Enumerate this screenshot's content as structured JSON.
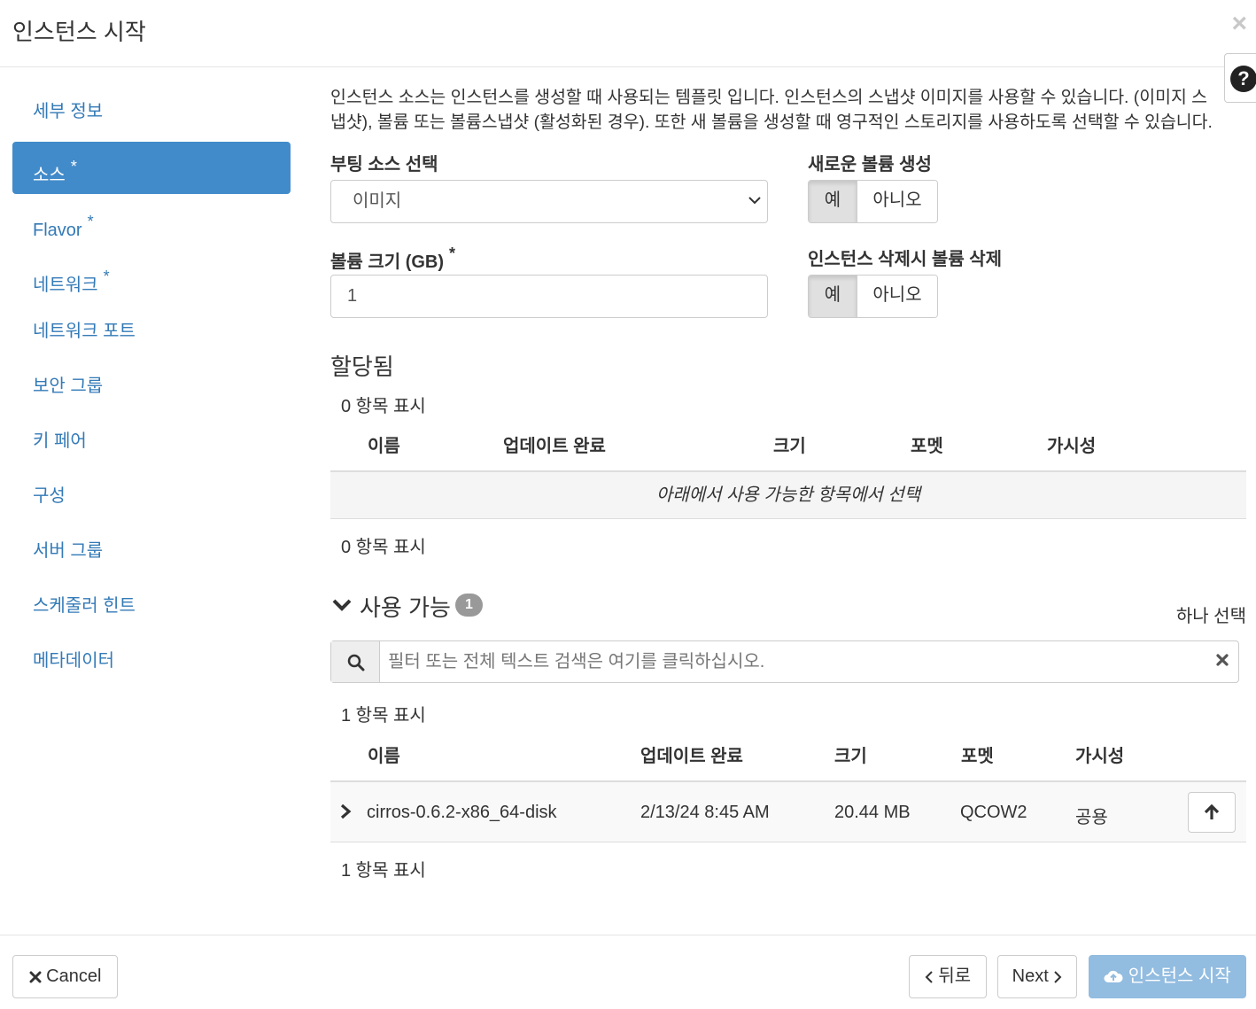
{
  "modal": {
    "title": "인스턴스 시작",
    "close_icon": "×",
    "help_icon": "?"
  },
  "sidebar": {
    "items": [
      {
        "label": "세부 정보",
        "required": false,
        "active": false
      },
      {
        "label": "소스",
        "required": true,
        "active": true
      },
      {
        "label": "Flavor",
        "required": true,
        "active": false
      },
      {
        "label": "네트워크",
        "required": true,
        "active": false
      },
      {
        "label": "네트워크 포트",
        "required": false,
        "active": false
      },
      {
        "label": "보안 그룹",
        "required": false,
        "active": false
      },
      {
        "label": "키 페어",
        "required": false,
        "active": false
      },
      {
        "label": "구성",
        "required": false,
        "active": false
      },
      {
        "label": "서버 그룹",
        "required": false,
        "active": false
      },
      {
        "label": "스케줄러 힌트",
        "required": false,
        "active": false
      },
      {
        "label": "메타데이터",
        "required": false,
        "active": false
      }
    ],
    "required_mark": "*"
  },
  "source": {
    "help_line1": "인스턴스 소스는 인스턴스를 생성할 때 사용되는 템플릿 입니다. 인스턴스의 스냅샷 이미지를 사용할 수 있습니다. (이미지 스",
    "help_line2": "냅샷), 볼륨 또는 볼륨스냅샷 (활성화된 경우). 또한 새 볼륨을 생성할 때 영구적인 스토리지를 사용하도록 선택할 수 있습니다.",
    "boot_source_label": "부팅 소스 선택",
    "boot_source_value": "이미지",
    "volume_size_label": "볼륨 크기 (GB)",
    "volume_size_value": "1",
    "new_volume_label": "새로운 볼륨 생성",
    "delete_volume_label": "인스턴스 삭제시 볼륨 삭제",
    "yes": "예",
    "no": "아니오"
  },
  "allocated": {
    "title": "할당됨",
    "count_top": "0 항목 표시",
    "count_bottom": "0 항목 표시",
    "columns": [
      "이름",
      "업데이트 완료",
      "크기",
      "포멧",
      "가시성"
    ],
    "empty_message": "아래에서 사용 가능한 항목에서 선택"
  },
  "available": {
    "title": "사용 가능",
    "badge": "1",
    "select_one": "하나 선택",
    "search_placeholder": "필터 또는 전체 텍스트 검색은 여기를 클릭하십시오.",
    "count_top": "1 항목 표시",
    "count_bottom": "1 항목 표시",
    "columns": [
      "이름",
      "업데이트 완료",
      "크기",
      "포멧",
      "가시성"
    ],
    "rows": [
      {
        "name": "cirros-0.6.2-x86_64-disk",
        "updated": "2/13/24 8:45 AM",
        "size": "20.44 MB",
        "format": "QCOW2",
        "visibility": "공용"
      }
    ]
  },
  "footer": {
    "cancel": "Cancel",
    "back": "뒤로",
    "next": "Next",
    "launch": "인스턴스 시작"
  },
  "colors": {
    "active_nav": "#428bca",
    "link": "#337ab7",
    "primary_disabled": "#92bce0",
    "badge": "#999999"
  },
  "icons": [
    "close-icon",
    "help-icon",
    "chevron-down-icon",
    "search-icon",
    "clear-icon",
    "chevron-right-icon",
    "arrow-up-icon",
    "times-icon",
    "cloud-upload-icon"
  ]
}
